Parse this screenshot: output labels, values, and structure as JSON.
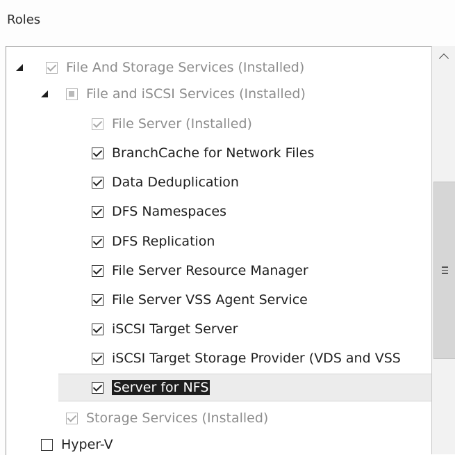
{
  "roles_heading": "Roles",
  "items": [
    {
      "label": "File And Storage Services (Installed)"
    },
    {
      "label": "File and iSCSI Services (Installed)"
    },
    {
      "label": "File Server (Installed)"
    },
    {
      "label": "BranchCache for Network Files"
    },
    {
      "label": "Data Deduplication"
    },
    {
      "label": "DFS Namespaces"
    },
    {
      "label": "DFS Replication"
    },
    {
      "label": "File Server Resource Manager"
    },
    {
      "label": "File Server VSS Agent Service"
    },
    {
      "label": "iSCSI Target Server"
    },
    {
      "label": "iSCSI Target Storage Provider (VDS and VSS"
    },
    {
      "label": "Server for NFS"
    },
    {
      "label": "Storage Services (Installed)"
    },
    {
      "label": "Hyper-V"
    }
  ],
  "icons": {
    "expander": "expander-triangle-icon",
    "scroll_up": "chevron-up-icon",
    "scroll_grip": "grip-icon"
  }
}
